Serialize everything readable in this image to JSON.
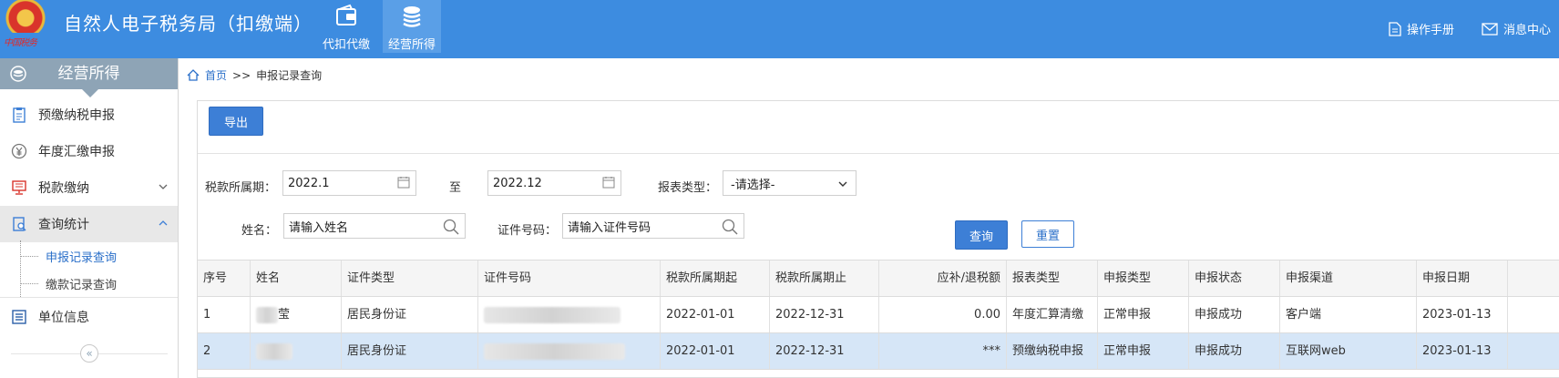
{
  "header": {
    "emblem_text": "中国税务",
    "app_title": "自然人电子税务局（扣缴端）",
    "nav": [
      {
        "label": "代扣代缴",
        "icon": "wallet-icon",
        "active": false
      },
      {
        "label": "经营所得",
        "icon": "coins-icon",
        "active": true
      }
    ],
    "manual_label": "操作手册",
    "message_label": "消息中心"
  },
  "sidebar": {
    "title": "经营所得",
    "items": [
      {
        "label": "预缴纳税申报",
        "icon": "clipboard-icon"
      },
      {
        "label": "年度汇缴申报",
        "icon": "yen-icon"
      },
      {
        "label": "税款缴纳",
        "icon": "monitor-icon"
      },
      {
        "label": "查询统计",
        "icon": "search-doc-icon"
      },
      {
        "label": "单位信息",
        "icon": "list-icon"
      }
    ],
    "subitems": [
      {
        "label": "申报记录查询",
        "active": true
      },
      {
        "label": "缴款记录查询",
        "active": false
      }
    ],
    "collapse_glyph": "«"
  },
  "breadcrumb": {
    "home": "首页",
    "separator": ">>",
    "current": "申报记录查询"
  },
  "toolbar": {
    "export_label": "导出"
  },
  "filters": {
    "period_label": "税款所属期：",
    "period_from": "2022.1",
    "period_to_sep": "至",
    "period_to": "2022.12",
    "report_type_label": "报表类型：",
    "report_type_value": "-请选择-",
    "name_label": "姓名：",
    "name_placeholder": "请输入姓名",
    "id_label": "证件号码：",
    "id_placeholder": "请输入证件号码",
    "query_label": "查询",
    "reset_label": "重置"
  },
  "table": {
    "columns": [
      "序号",
      "姓名",
      "证件类型",
      "证件号码",
      "税款所属期起",
      "税款所属期止",
      "应补/退税额",
      "报表类型",
      "申报类型",
      "申报状态",
      "申报渠道",
      "申报日期"
    ],
    "rows": [
      {
        "idx": "1",
        "name": "莹",
        "id_type": "居民身份证",
        "id_no": "",
        "start": "2022-01-01",
        "end": "2022-12-31",
        "amount": "0.00",
        "report_type": "年度汇算清缴",
        "decl_type": "正常申报",
        "status": "申报成功",
        "channel": "客户端",
        "date": "2023-01-13"
      },
      {
        "idx": "2",
        "name": "",
        "id_type": "居民身份证",
        "id_no": "",
        "start": "2022-01-01",
        "end": "2022-12-31",
        "amount": "***",
        "report_type": "预缴纳税申报",
        "decl_type": "正常申报",
        "status": "申报成功",
        "channel": "互联网web",
        "date": "2023-01-13"
      }
    ]
  },
  "colors": {
    "topbar": "#3d8ce0",
    "accent": "#3d7fd6",
    "sidebar_head": "#8ea4b6",
    "selected_row": "#d6e6f7"
  }
}
